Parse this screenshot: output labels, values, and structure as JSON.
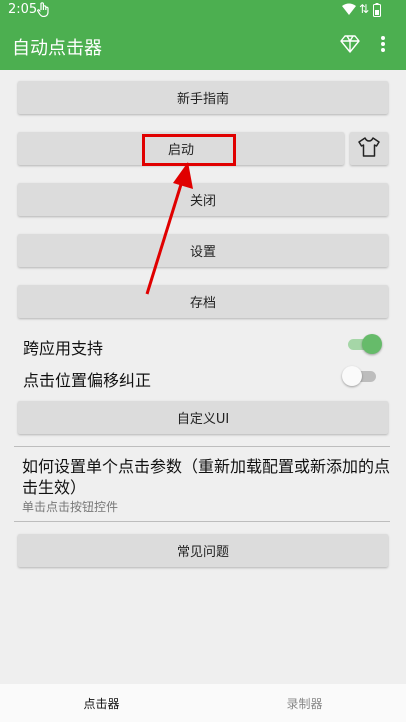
{
  "status_bar": {
    "time": "2:05"
  },
  "app_bar": {
    "title": "自动点击器"
  },
  "buttons": {
    "guide": "新手指南",
    "start": "启动",
    "close": "关闭",
    "settings": "设置",
    "save": "存档",
    "custom_ui": "自定义UI",
    "faq": "常见问题"
  },
  "settings": {
    "cross_app": {
      "label": "跨应用支持",
      "enabled": true
    },
    "offset_correction": {
      "label": "点击位置偏移纠正",
      "enabled": false
    }
  },
  "help": {
    "title": "如何设置单个点击参数（重新加载配置或新添加的点击生效）",
    "subtitle": "单击点击按钮控件"
  },
  "bottom_nav": {
    "clicker": "点击器",
    "recorder": "录制器"
  },
  "colors": {
    "accent": "#4caf50",
    "annotation": "#e00000"
  }
}
